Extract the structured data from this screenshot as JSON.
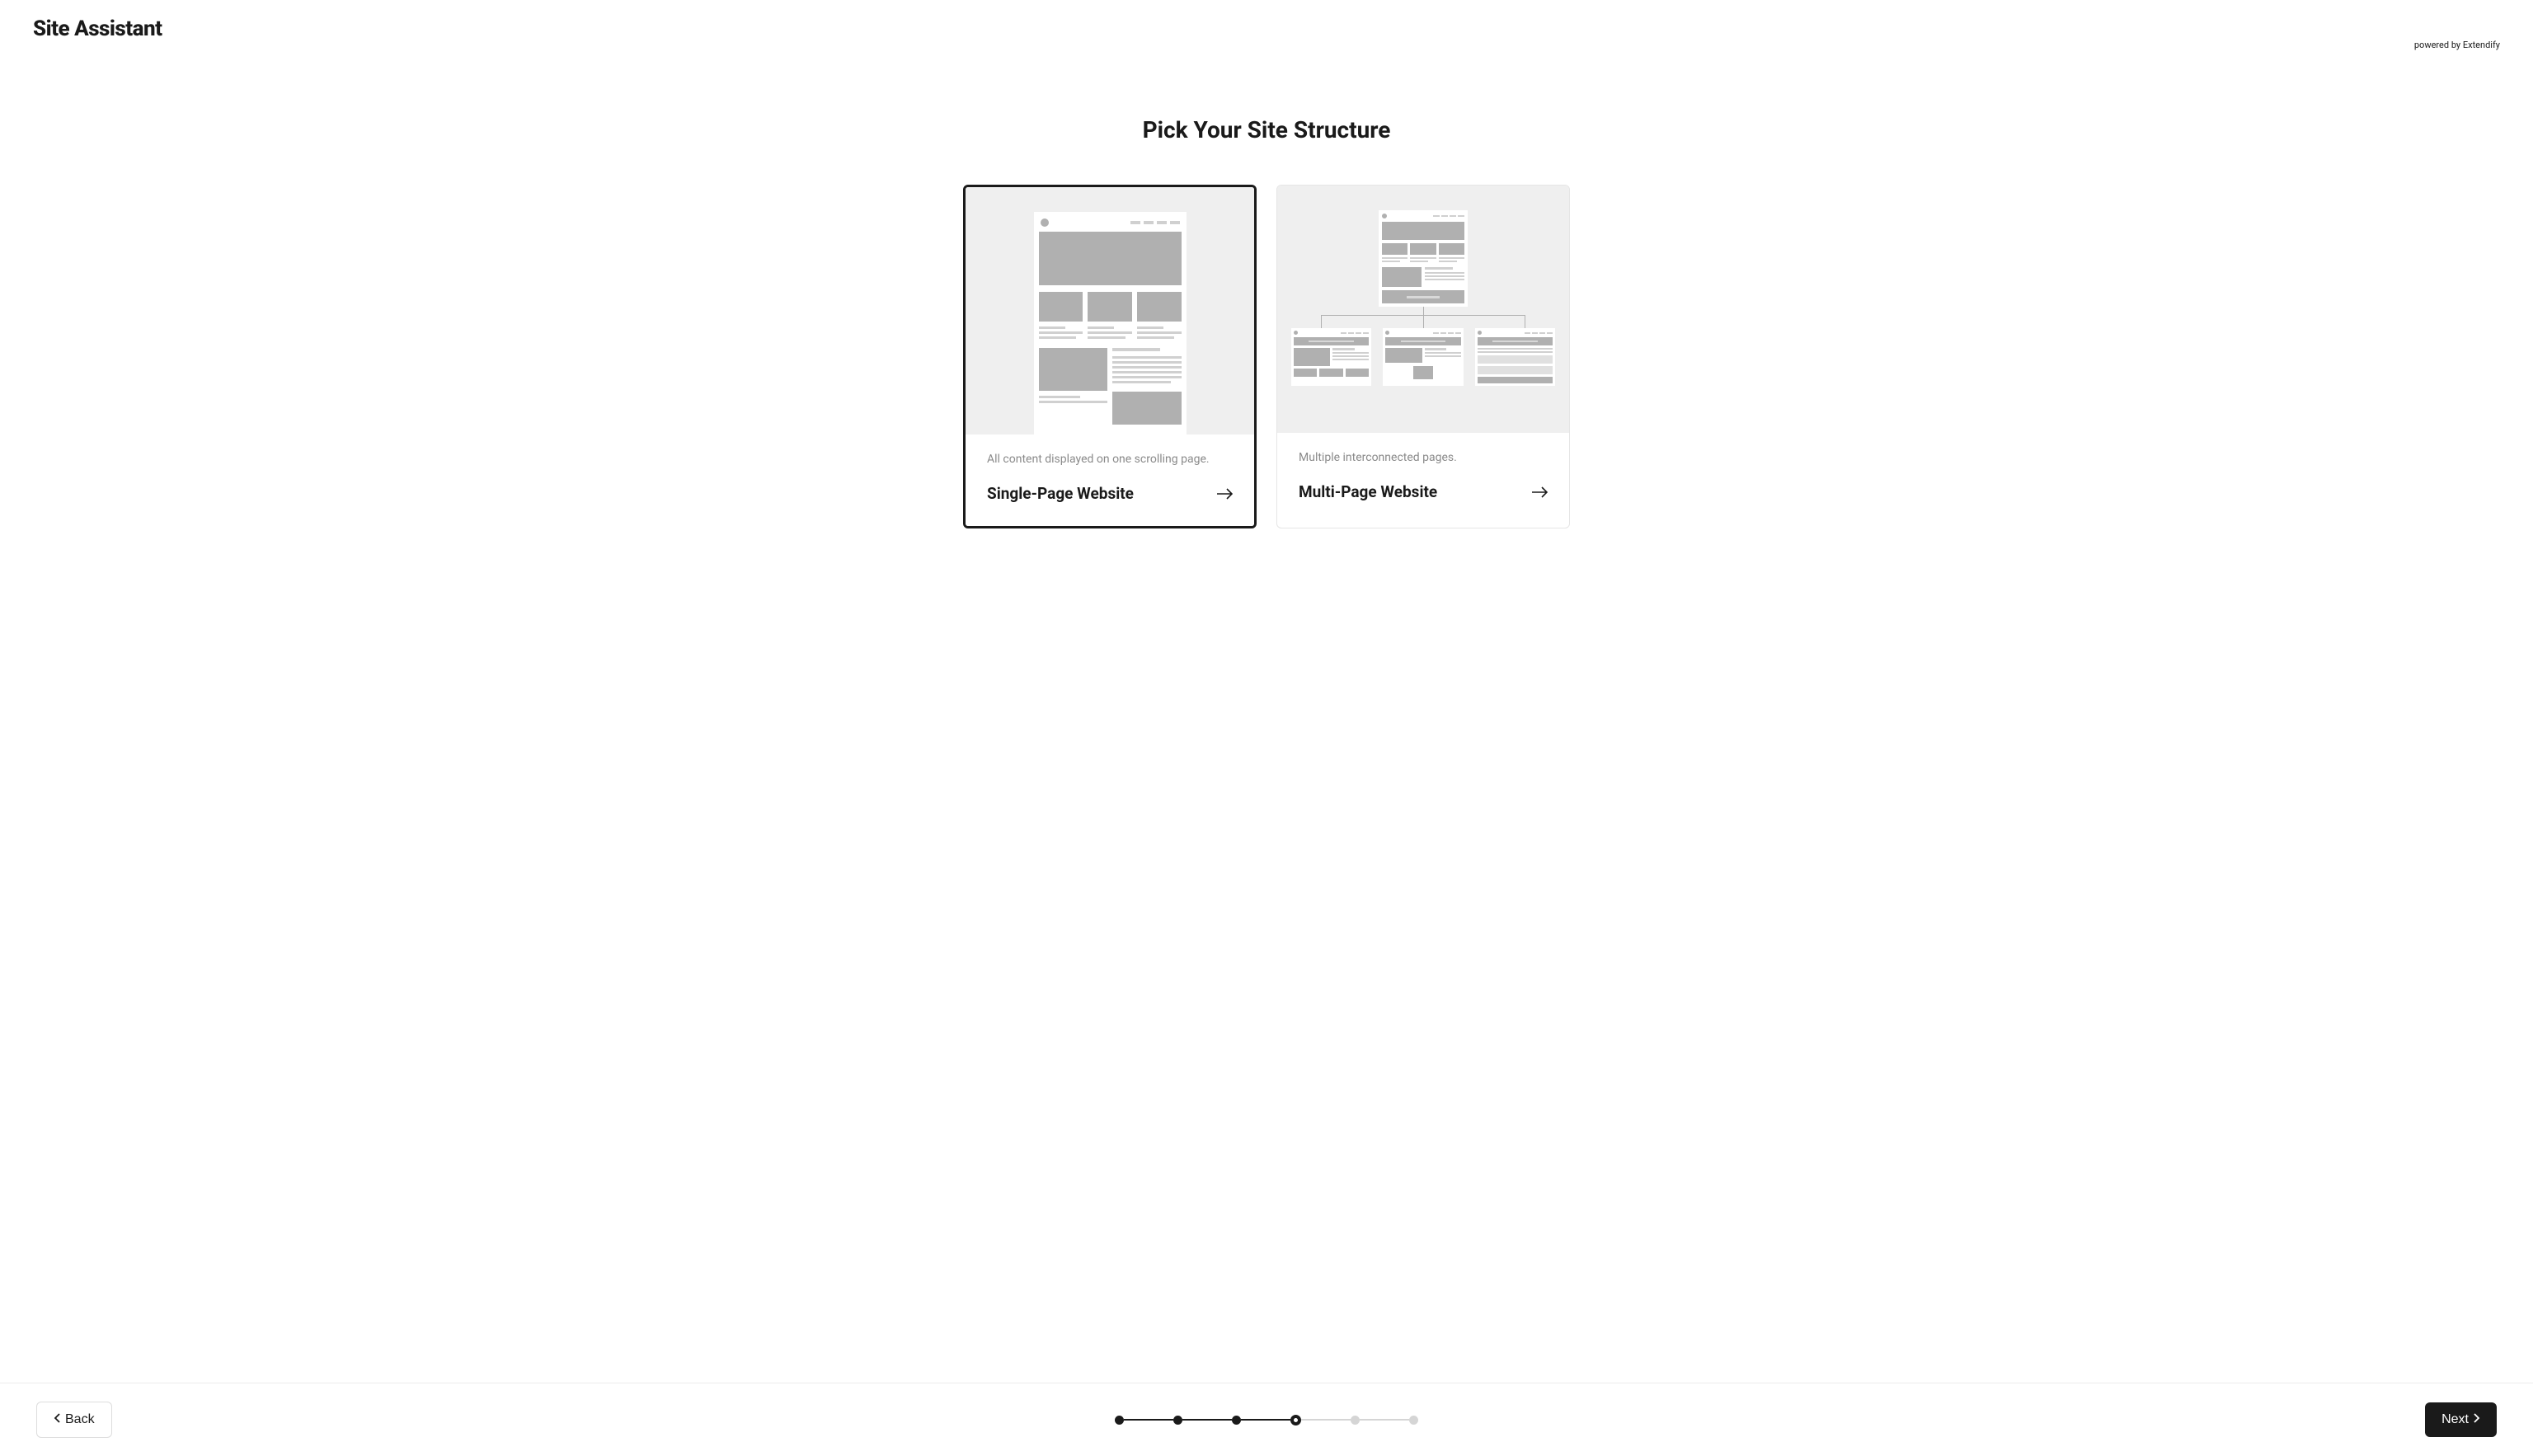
{
  "brand": {
    "title": "Site Assistant",
    "subtitle": "powered by Extendify"
  },
  "page": {
    "title": "Pick Your Site Structure"
  },
  "options": [
    {
      "description": "All content displayed on one scrolling page.",
      "title": "Single-Page Website",
      "selected": true
    },
    {
      "description": "Multiple interconnected pages.",
      "title": "Multi-Page Website",
      "selected": false
    }
  ],
  "footer": {
    "back_label": "Back",
    "next_label": "Next"
  },
  "progress": {
    "total_steps": 6,
    "current_step": 4
  }
}
